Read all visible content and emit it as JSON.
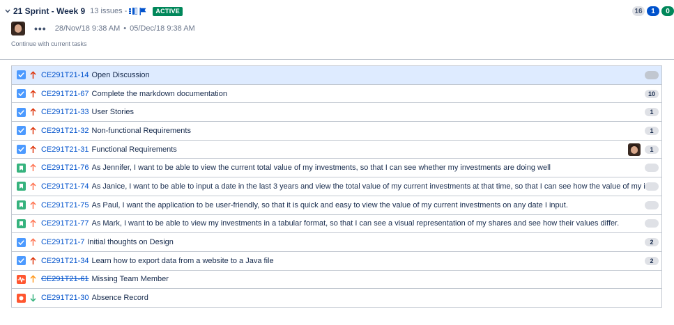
{
  "sprint": {
    "title": "21 Sprint - Week 9",
    "issues": "13 issues",
    "dash": "-",
    "status": "ACTIVE",
    "counts": {
      "todo": "16",
      "in_progress": "1",
      "done": "0"
    },
    "start": "28/Nov/18 9:38 AM",
    "separator": "•",
    "end": "05/Dec/18 9:38 AM",
    "goal": "Continue with current tasks",
    "more_label": "•••"
  },
  "colors": {
    "task": "#4c9aff",
    "story": "#36b37e",
    "bug": "#ff5630",
    "highest": "#de350b",
    "high": "#ff7452",
    "medium": "#ff991f",
    "low": "#36b37e",
    "link": "#0052cc",
    "selected_row": "#deebff"
  },
  "issues": [
    {
      "key": "CE291T21-14",
      "summary": "Open Discussion",
      "type": "task",
      "type_icon": "checkbox-icon",
      "priority": "highest",
      "priority_icon": "arrow-up-icon",
      "estimate": "",
      "selected": true,
      "done": false,
      "assignee": false
    },
    {
      "key": "CE291T21-67",
      "summary": "Complete the markdown documentation",
      "type": "task",
      "type_icon": "checkbox-icon",
      "priority": "highest",
      "priority_icon": "arrow-up-icon",
      "estimate": "10",
      "selected": false,
      "done": false,
      "assignee": false
    },
    {
      "key": "CE291T21-33",
      "summary": "User Stories",
      "type": "task",
      "type_icon": "checkbox-icon",
      "priority": "highest",
      "priority_icon": "arrow-up-icon",
      "estimate": "1",
      "selected": false,
      "done": false,
      "assignee": false
    },
    {
      "key": "CE291T21-32",
      "summary": "Non-functional Requirements",
      "type": "task",
      "type_icon": "checkbox-icon",
      "priority": "highest",
      "priority_icon": "arrow-up-icon",
      "estimate": "1",
      "selected": false,
      "done": false,
      "assignee": false
    },
    {
      "key": "CE291T21-31",
      "summary": "Functional Requirements",
      "type": "task",
      "type_icon": "checkbox-icon",
      "priority": "highest",
      "priority_icon": "arrow-up-icon",
      "estimate": "1",
      "selected": false,
      "done": false,
      "assignee": true
    },
    {
      "key": "CE291T21-76",
      "summary": "As Jennifer, I want to be able to view the current total value of my investments, so that I can see whether my investments are doing well",
      "type": "story",
      "type_icon": "bookmark-icon",
      "priority": "high",
      "priority_icon": "arrow-up-icon",
      "estimate": "",
      "selected": false,
      "done": false,
      "assignee": false
    },
    {
      "key": "CE291T21-74",
      "summary": "As Janice, I want to be able to input a date in the last 3 years and view the total value of my current investments at that time, so that I can see how the value of my investments changed",
      "type": "story",
      "type_icon": "bookmark-icon",
      "priority": "high",
      "priority_icon": "arrow-up-icon",
      "estimate": "",
      "selected": false,
      "done": false,
      "assignee": false
    },
    {
      "key": "CE291T21-75",
      "summary": "As Paul, I want the application to be user-friendly, so that it is quick and easy to view the value of my current investments on any date I input.",
      "type": "story",
      "type_icon": "bookmark-icon",
      "priority": "high",
      "priority_icon": "arrow-up-icon",
      "estimate": "",
      "selected": false,
      "done": false,
      "assignee": false
    },
    {
      "key": "CE291T21-77",
      "summary": "As Mark, I want to be able to view my investments in a tabular format, so that I can see a visual representation of my shares and see how their values differ.",
      "type": "story",
      "type_icon": "bookmark-icon",
      "priority": "high",
      "priority_icon": "arrow-up-icon",
      "estimate": "",
      "selected": false,
      "done": false,
      "assignee": false
    },
    {
      "key": "CE291T21-7",
      "summary": "Initial thoughts on Design",
      "type": "task",
      "type_icon": "checkbox-icon",
      "priority": "high",
      "priority_icon": "arrow-up-icon",
      "estimate": "2",
      "selected": false,
      "done": false,
      "assignee": false
    },
    {
      "key": "CE291T21-34",
      "summary": "Learn how to export data from a website to a Java file",
      "type": "task",
      "type_icon": "checkbox-icon",
      "priority": "highest",
      "priority_icon": "arrow-up-icon",
      "estimate": "2",
      "selected": false,
      "done": false,
      "assignee": false
    },
    {
      "key": "CE291T21-61",
      "summary": "Missing Team Member",
      "type": "incident",
      "type_icon": "pulse-icon",
      "priority": "medium",
      "priority_icon": "arrow-up-icon",
      "estimate": "",
      "selected": false,
      "done": true,
      "assignee": false
    },
    {
      "key": "CE291T21-30",
      "summary": "Absence Record",
      "type": "bug",
      "type_icon": "dot-icon",
      "priority": "low",
      "priority_icon": "arrow-down-icon",
      "estimate": "",
      "selected": false,
      "done": false,
      "assignee": false
    }
  ]
}
